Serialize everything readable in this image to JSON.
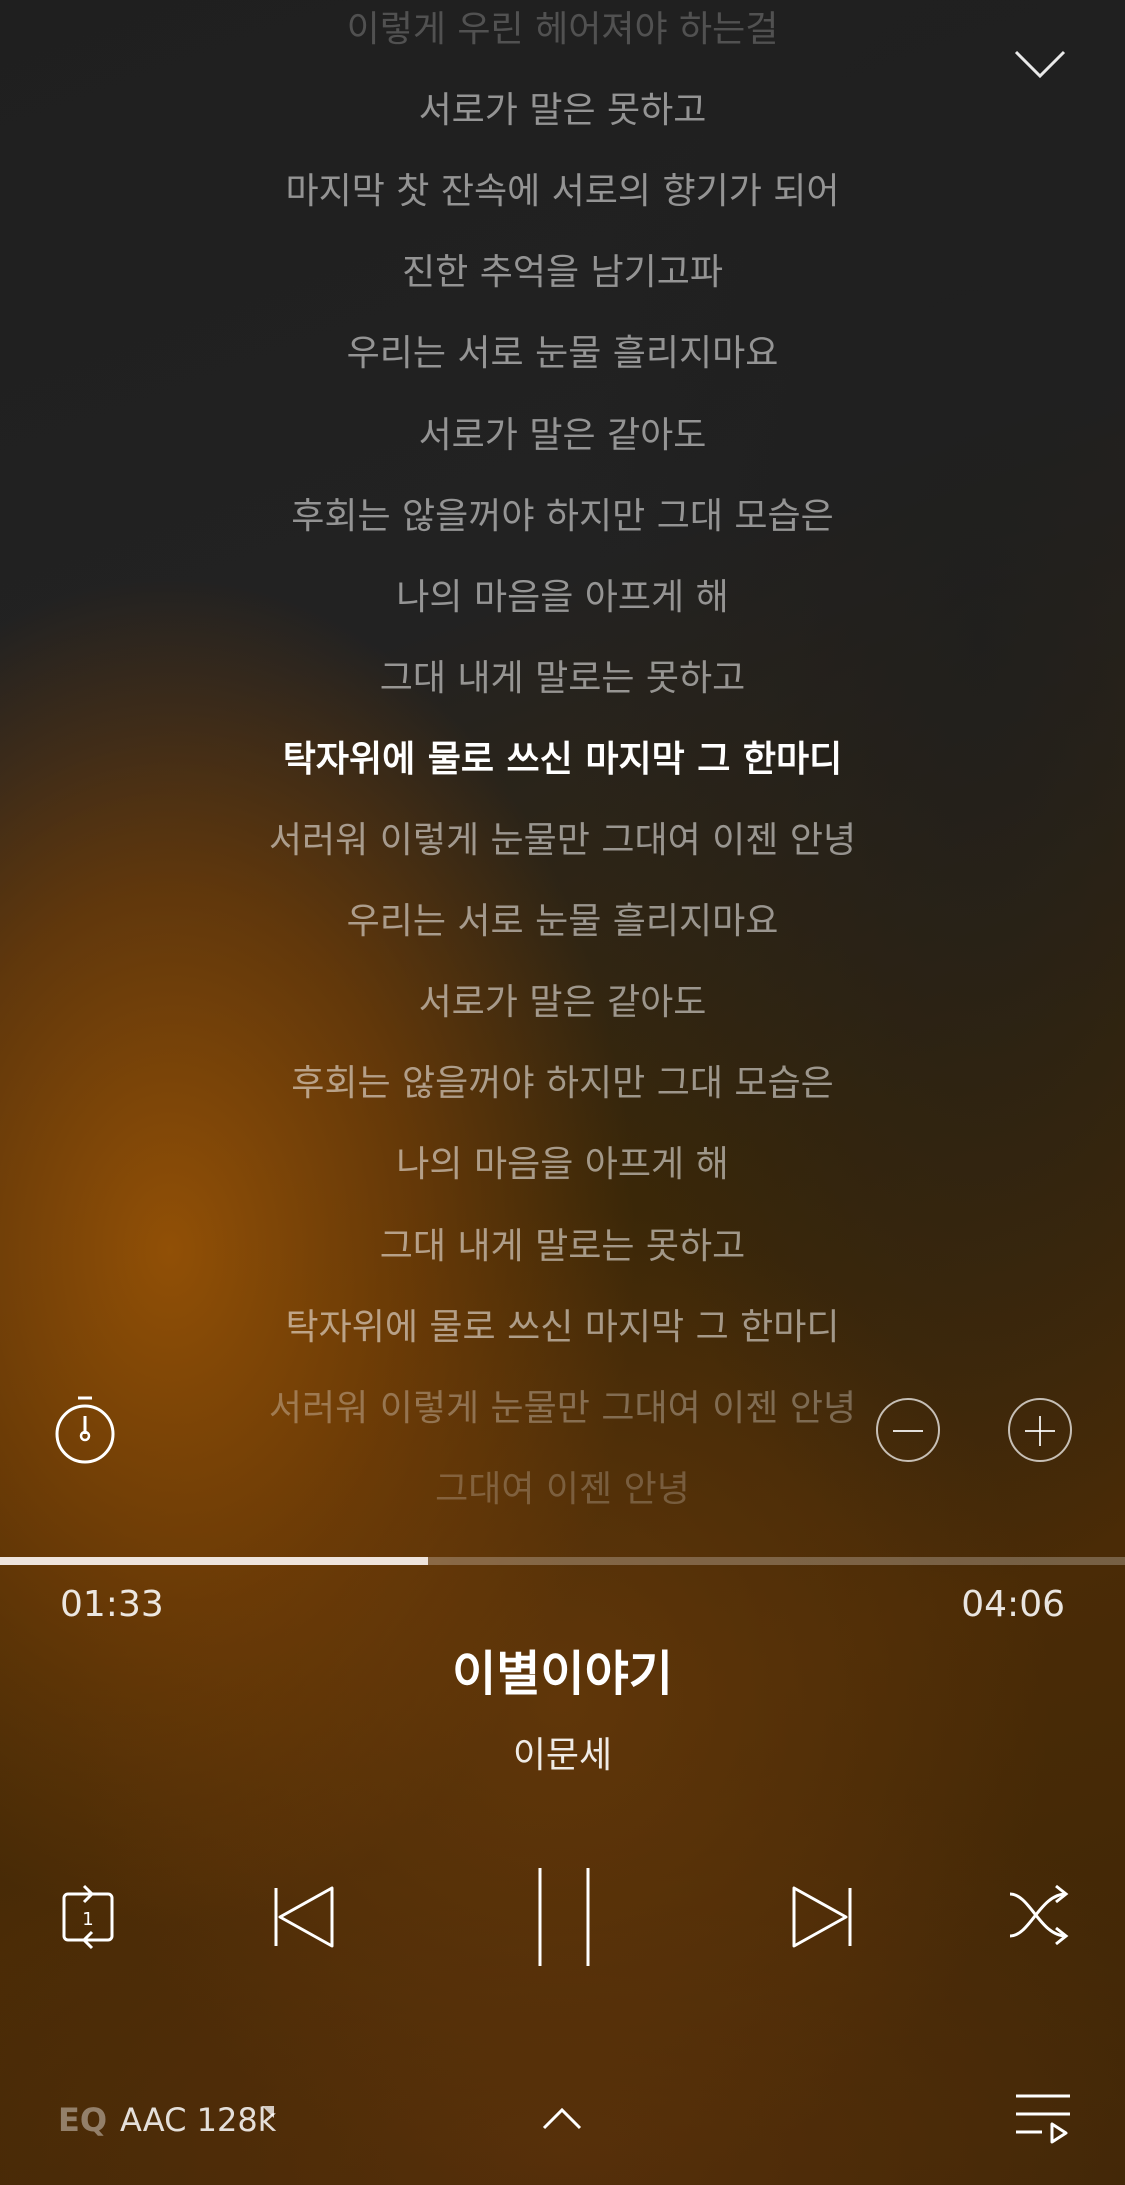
{
  "lyrics": {
    "lines": [
      "이렇게 우린 헤어져야 하는걸",
      "서로가 말은 못하고",
      "마지막 찻 잔속에 서로의 향기가 되어",
      "진한 추억을 남기고파",
      "우리는 서로 눈물 흘리지마요",
      "서로가 말은 같아도",
      "후회는 않을꺼야 하지만 그대 모습은",
      "나의 마음을 아프게 해",
      "그대 내게 말로는 못하고",
      "탁자위에 물로 쓰신 마지막 그 한마디",
      "서러워 이렇게 눈물만 그대여 이젠 안녕",
      "우리는 서로 눈물 흘리지마요",
      "서로가 말은 같아도",
      "후회는 않을꺼야 하지만 그대 모습은",
      "나의 마음을 아프게 해",
      "그대 내게 말로는 못하고",
      "탁자위에 물로 쓰신 마지막 그 한마디",
      "서러워 이렇게 눈물만 그대여 이젠 안녕",
      "그대여 이젠 안녕"
    ],
    "active_index": 9
  },
  "player": {
    "current_time": "01:33",
    "total_time": "04:06",
    "progress": 0.38,
    "title": "이별이야기",
    "artist": "이문세",
    "repeat_mode_label": "1"
  },
  "bottom": {
    "eq_label": "EQ",
    "quality_label": "AAC 128k"
  },
  "icons": {
    "collapse": "chevron-down-icon",
    "timer": "stopwatch-icon",
    "font_smaller": "minus-icon",
    "font_larger": "plus-icon",
    "repeat": "repeat-one-icon",
    "previous": "skip-previous-icon",
    "play_state": "pause-icon",
    "next": "skip-next-icon",
    "shuffle": "shuffle-icon",
    "expand": "chevron-up-icon",
    "playlist": "playlist-icon"
  },
  "colors": {
    "progress_fill": "#efe4dc",
    "accent_bg": "#8a4c06"
  }
}
